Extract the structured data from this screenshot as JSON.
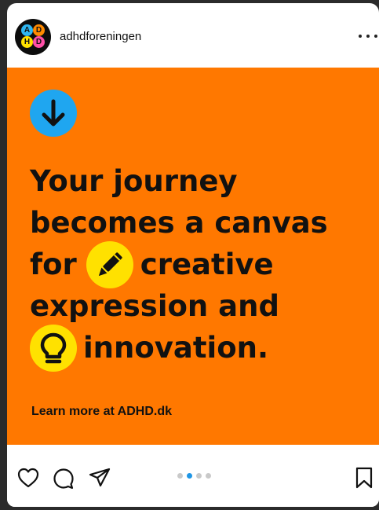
{
  "account": {
    "username": "adhdforeningen",
    "logo_letters": [
      "A",
      "D",
      "H",
      "D"
    ]
  },
  "post": {
    "background_color": "#ff7800",
    "headline_lines": [
      {
        "text": "Your journey"
      },
      {
        "text": "becomes a canvas"
      },
      {
        "before": "for",
        "emoji": "pencil-icon",
        "after": "creative"
      },
      {
        "text": "expression and"
      },
      {
        "emoji": "lightbulb-icon",
        "after": "innovation."
      }
    ],
    "cta": "Learn more at ADHD.dk"
  },
  "actions": {
    "icons": [
      "heart-icon",
      "comment-icon",
      "share-icon",
      "bookmark-icon"
    ]
  },
  "carousel": {
    "total_slides": 4,
    "current_slide": 2
  },
  "colors": {
    "accent_blue": "#1fa6f0",
    "emoji_yellow": "#ffe100",
    "active_dot": "#1e96e6"
  }
}
